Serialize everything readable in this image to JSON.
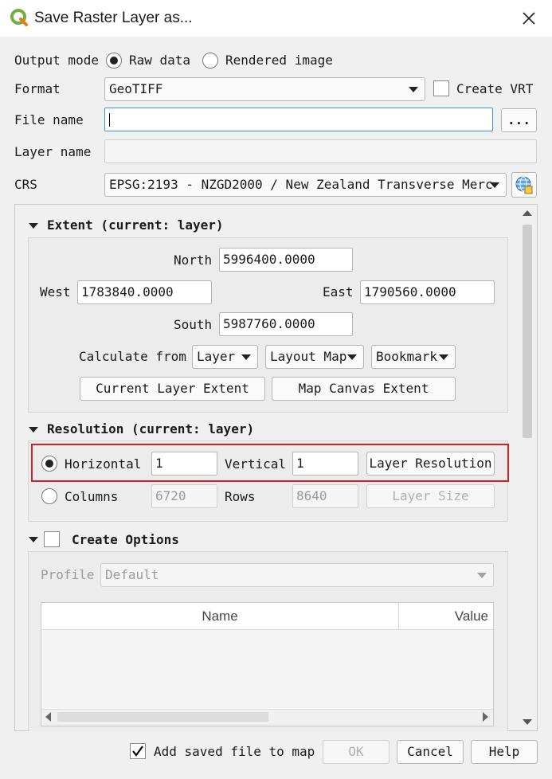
{
  "window": {
    "title": "Save Raster Layer as..."
  },
  "output_mode": {
    "label": "Output mode",
    "options": [
      "Raw data",
      "Rendered image"
    ],
    "selected": "Raw data"
  },
  "format": {
    "label": "Format",
    "value": "GeoTIFF",
    "create_vrt_label": "Create VRT",
    "create_vrt_checked": false
  },
  "file_name": {
    "label": "File name",
    "value": "",
    "browse_label": "..."
  },
  "layer_name": {
    "label": "Layer name",
    "value": ""
  },
  "crs": {
    "label": "CRS",
    "value": "EPSG:2193 - NZGD2000 / New Zealand Transverse Merc"
  },
  "extent": {
    "title": "Extent (current: layer)",
    "north_label": "North",
    "north": "5996400.0000",
    "west_label": "West",
    "west": "1783840.0000",
    "east_label": "East",
    "east": "1790560.0000",
    "south_label": "South",
    "south": "5987760.0000",
    "calc_label": "Calculate from",
    "calc_layer": "Layer",
    "calc_layout_map": "Layout Map",
    "calc_bookmark": "Bookmark",
    "current_layer_extent": "Current Layer Extent",
    "map_canvas_extent": "Map Canvas Extent"
  },
  "resolution": {
    "title": "Resolution (current: layer)",
    "horizontal_label": "Horizontal",
    "horizontal": "1",
    "vertical_label": "Vertical",
    "vertical": "1",
    "layer_resolution": "Layer Resolution",
    "columns_label": "Columns",
    "columns": "6720",
    "rows_label": "Rows",
    "rows": "8640",
    "layer_size": "Layer Size"
  },
  "create_options": {
    "title": "Create Options",
    "profile_label": "Profile",
    "profile_value": "Default",
    "columns": [
      "Name",
      "Value"
    ]
  },
  "footer": {
    "add_saved_label": "Add saved file to map",
    "add_saved_checked": true,
    "ok": "OK",
    "cancel": "Cancel",
    "help": "Help"
  },
  "colors": {
    "highlight": "#d4202a",
    "focus": "#3c8fd8",
    "qgis_green": "#6fb03f"
  }
}
